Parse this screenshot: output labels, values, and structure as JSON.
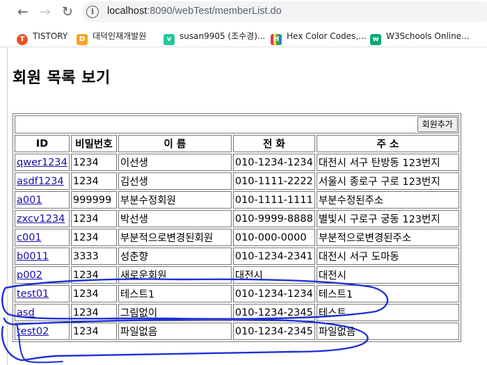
{
  "browser": {
    "url_host": "localhost",
    "url_path": ":8090/webTest/memberList.do",
    "back_glyph": "←",
    "forward_glyph": "→",
    "reload_glyph": "↻",
    "info_glyph": "i",
    "bookmarks": [
      {
        "label": "TISTORY",
        "icon": "tistory-icon",
        "color": "#eb531f",
        "glyph": "T"
      },
      {
        "label": "대덕인재개발원",
        "icon": "school-icon",
        "color": "#f5a623",
        "glyph": "D"
      },
      {
        "label": "susan9905 (조수경)...",
        "icon": "velog-icon",
        "color": "#20c997",
        "glyph": "v"
      },
      {
        "label": "Hex Color Codes,...",
        "icon": "color-book-icon",
        "color": "#6c4ab6",
        "glyph": "H"
      },
      {
        "label": "W3Schools Online...",
        "icon": "w3schools-icon",
        "color": "#04aa6d",
        "glyph": "w"
      }
    ]
  },
  "page": {
    "title": "회원 목록 보기",
    "add_button": "회원추가",
    "columns": [
      "ID",
      "비밀번호",
      "이 름",
      "전 화",
      "주 소"
    ],
    "rows": [
      [
        "qwer1234",
        "1234",
        "이선생",
        "010-1234-1234",
        "대전시 서구 탄방동 123번지"
      ],
      [
        "asdf1234",
        "1234",
        "김선생",
        "010-1111-2222",
        "서울시 종로구 구로 123번지"
      ],
      [
        "a001",
        "999999",
        "부분수정회원",
        "010-1111-1111",
        "부분수정된주소"
      ],
      [
        "zxcv1234",
        "1234",
        "박선생",
        "010-9999-8888",
        "별빛시 구로구 궁동 123번지"
      ],
      [
        "c001",
        "1234",
        "부분적으로변경된회원",
        "010-000-0000",
        "부분적으로변경된주소"
      ],
      [
        "b0011",
        "3333",
        "성춘향",
        "010-1234-2341",
        "대전시 서구 도마동"
      ],
      [
        "p002",
        "1234",
        "새로운회원",
        "대전시",
        "대전시"
      ],
      [
        "test01",
        "1234",
        "테스트1",
        "010-1234-1234",
        "테스트1"
      ],
      [
        "asd",
        "1234",
        "그림없이",
        "010-1234-2345",
        "테스트"
      ],
      [
        "test02",
        "1234",
        "파일없음",
        "010-1234-2345",
        "파일없음"
      ]
    ]
  },
  "colors": {
    "link": "#1a0dab",
    "annotation_ink": "#1f2fd6",
    "border": "#777777"
  }
}
